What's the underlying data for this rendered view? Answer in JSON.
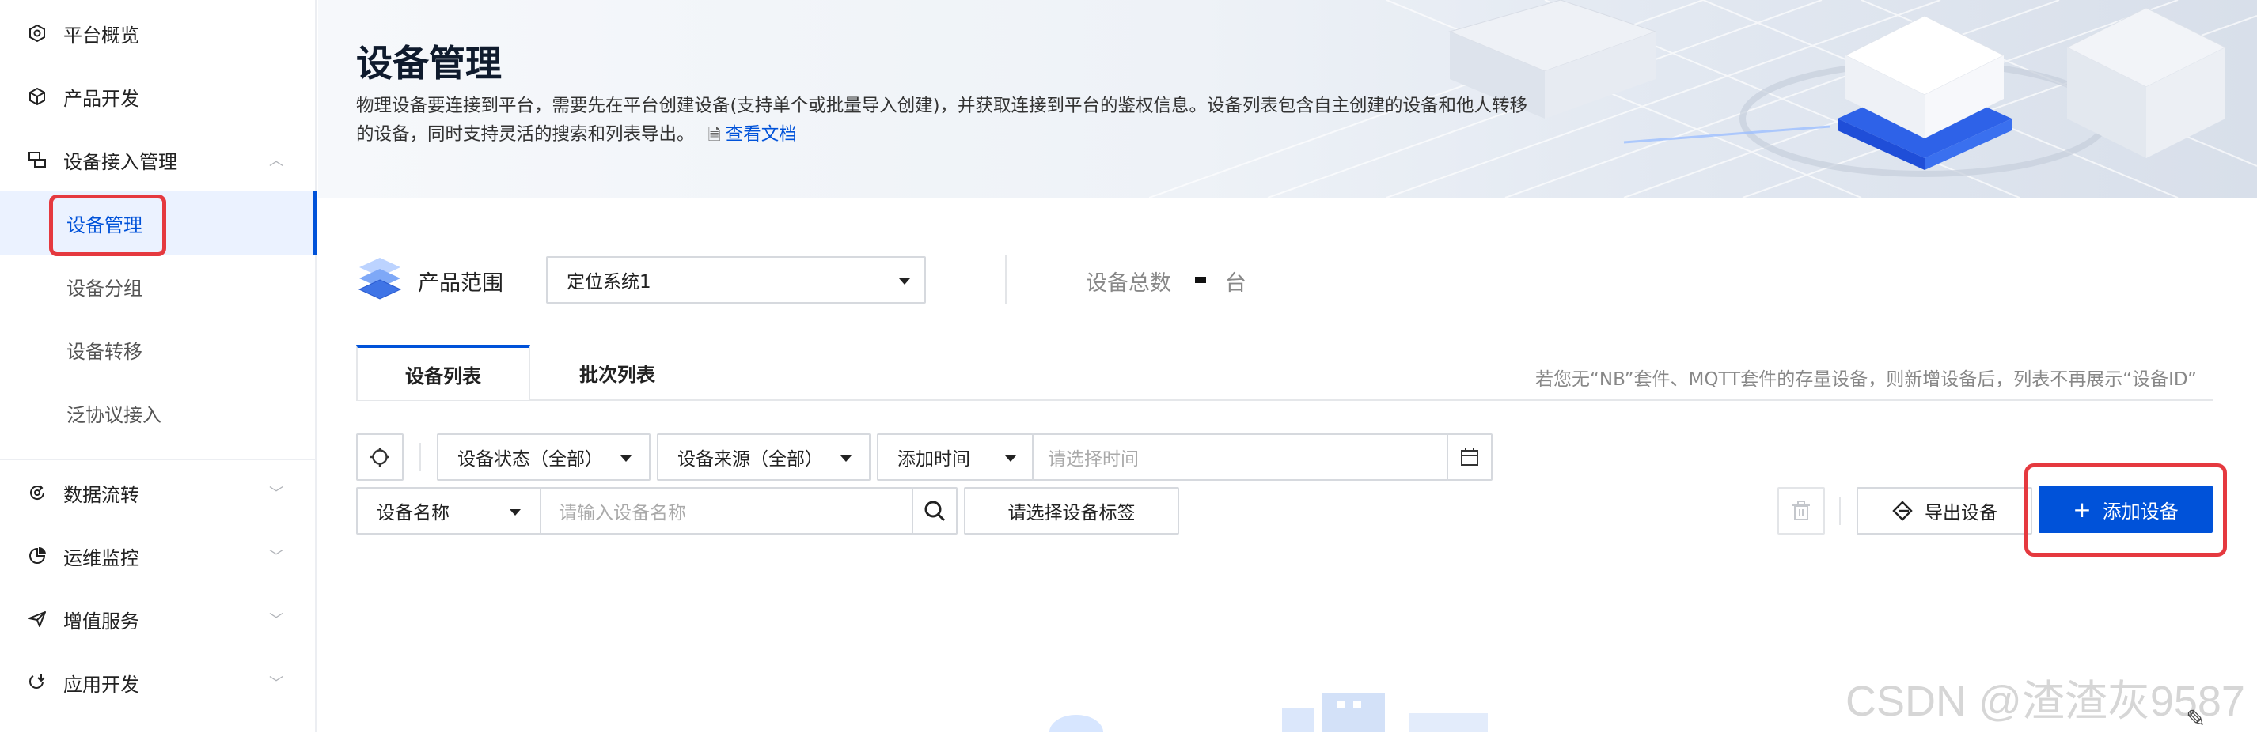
{
  "sidebar": {
    "items": [
      {
        "label": "平台概览",
        "icon": "hexagon-icon"
      },
      {
        "label": "产品开发",
        "icon": "cube-icon"
      },
      {
        "label": "设备接入管理",
        "icon": "device-access-icon",
        "expanded": true,
        "children": [
          {
            "label": "设备管理",
            "active": true
          },
          {
            "label": "设备分组"
          },
          {
            "label": "设备转移"
          },
          {
            "label": "泛协议接入"
          }
        ]
      },
      {
        "label": "数据流转",
        "icon": "data-flow-icon"
      },
      {
        "label": "运维监控",
        "icon": "pie-chart-icon"
      },
      {
        "label": "增值服务",
        "icon": "send-icon"
      },
      {
        "label": "应用开发",
        "icon": "app-dev-icon"
      }
    ]
  },
  "header": {
    "title": "设备管理",
    "description_line1": "物理设备要连接到平台，需要先在平台创建设备(支持单个或批量导入创建)，并获取连接到平台的鉴权信息。设备列表包含自主创建的设备和他人转移",
    "description_line2": "的设备，同时支持灵活的搜索和列表导出。",
    "doc_link": "查看文档"
  },
  "scope": {
    "label": "产品范围",
    "selected": "定位系统1",
    "total_label": "设备总数",
    "total_unit": "台"
  },
  "tabs": [
    {
      "label": "设备列表",
      "active": true
    },
    {
      "label": "批次列表",
      "active": false
    }
  ],
  "tab_note": "若您无“NB”套件、MQTT套件的存量设备，则新增设备后，列表不再展示“设备ID”",
  "filters": {
    "status": "设备状态（全部）",
    "source": "设备来源（全部）",
    "time_type": "添加时间",
    "time_placeholder": "请选择时间",
    "name_field": "设备名称",
    "name_placeholder": "请输入设备名称",
    "tag_button": "请选择设备标签"
  },
  "actions": {
    "export": "导出设备",
    "add": "添加设备"
  },
  "watermark": "CSDN @渣渣灰9587",
  "colors": {
    "primary": "#0052d9",
    "highlight_red": "#e5393f",
    "active_bg": "#ebf2ff"
  }
}
